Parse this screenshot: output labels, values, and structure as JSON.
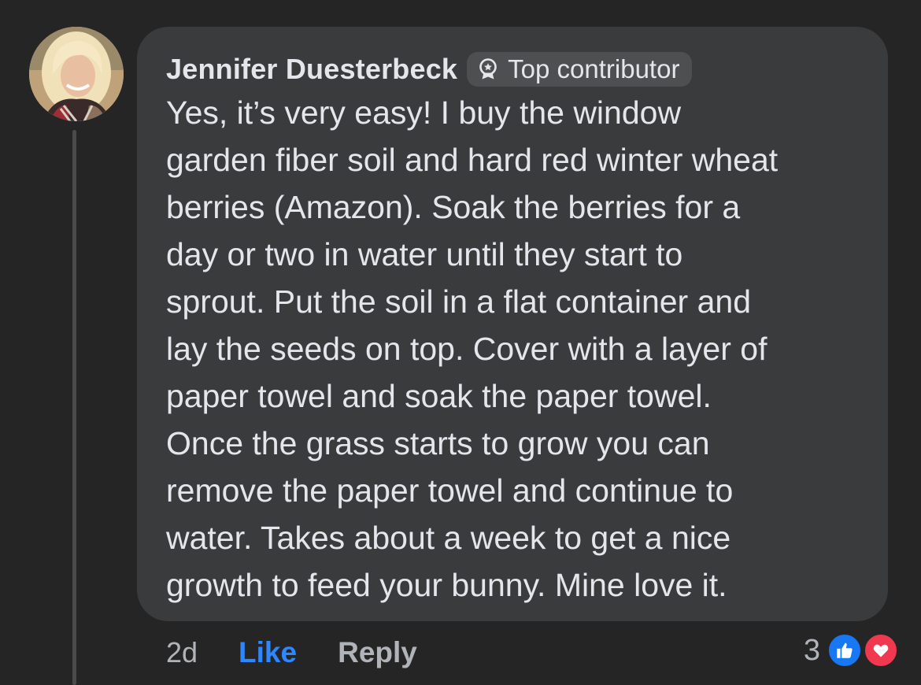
{
  "comment": {
    "author": "Jennifer Duesterbeck",
    "badge_label": "Top contributor",
    "badge_icon": "award-ribbon-icon",
    "text_lines": [
      "Yes, it’s very easy! I buy the window",
      "garden fiber soil and hard red winter wheat",
      "berries (Amazon). Soak the berries for a",
      "day or two in water until they start to",
      "sprout. Put the soil in a flat container and",
      "lay the seeds on top. Cover with a layer of",
      "paper towel and soak the paper towel.",
      "Once the grass starts to grow you can",
      "remove the paper towel and continue to",
      "water. Takes about a week to get a nice",
      "growth to feed your bunny. Mine love it."
    ]
  },
  "actions": {
    "time": "2d",
    "like_label": "Like",
    "reply_label": "Reply"
  },
  "reactions": {
    "count": "3",
    "types": [
      "like-icon",
      "love-icon"
    ]
  },
  "colors": {
    "background": "#252526",
    "bubble": "#3a3b3c",
    "text": "#e4e6eb",
    "secondary_text": "#b0b3b8",
    "like_blue": "#2d88ff",
    "reaction_like": "#1877f2",
    "reaction_love": "#f0384e"
  }
}
